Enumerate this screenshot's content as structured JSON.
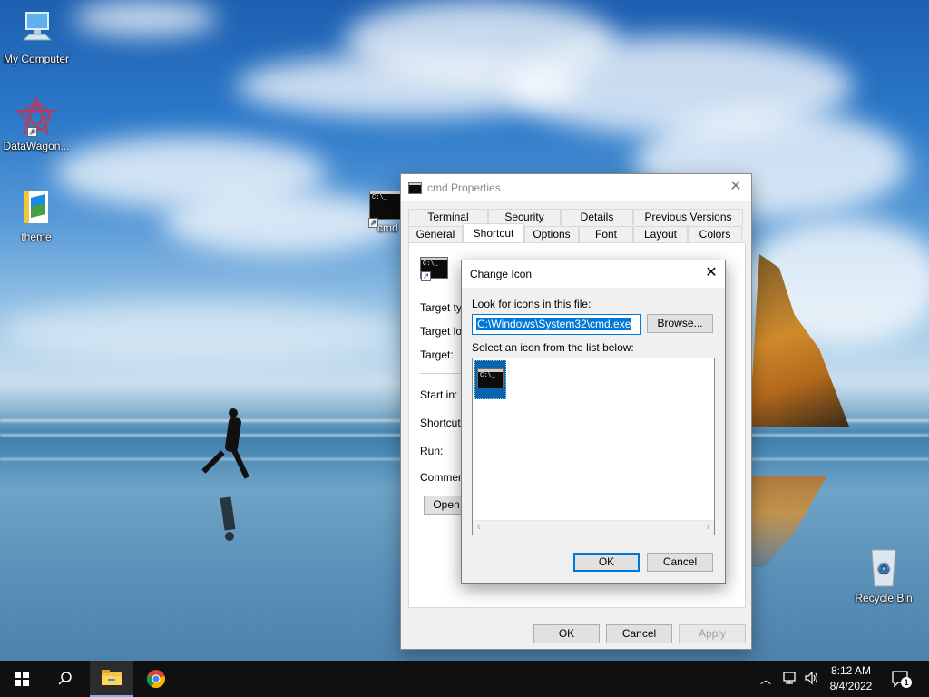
{
  "desktop": {
    "icons": [
      {
        "label": "My Computer"
      },
      {
        "label": "DataWagon..."
      },
      {
        "label": "theme"
      },
      {
        "label": "cmd"
      },
      {
        "label": "Recycle Bin"
      }
    ]
  },
  "properties_window": {
    "title": "cmd Properties",
    "tabs_row1": [
      "Terminal",
      "Security",
      "Details",
      "Previous Versions"
    ],
    "tabs_row2": [
      "General",
      "Shortcut",
      "Options",
      "Font",
      "Layout",
      "Colors"
    ],
    "active_tab": "Shortcut",
    "fields": {
      "target_type": "Target typ",
      "target_location": "Target loc",
      "target": "Target:",
      "start_in": "Start in:",
      "shortcut_key": "Shortcut k",
      "run": "Run:",
      "comment": "Comment:"
    },
    "open_button": "Open",
    "ok": "OK",
    "cancel": "Cancel",
    "apply": "Apply"
  },
  "change_icon_dialog": {
    "title": "Change Icon",
    "look_for_label": "Look for icons in this file:",
    "path_value": "C:\\Windows\\System32\\cmd.exe",
    "browse_button": "Browse...",
    "select_label": "Select an icon from the list below:",
    "ok": "OK",
    "cancel": "Cancel"
  },
  "cmd_glyph_text": "C:\\_",
  "taskbar": {
    "time": "8:12 AM",
    "date": "8/4/2022",
    "notification_count": "1"
  },
  "colors": {
    "accent": "#0078d7",
    "taskbar": "#101010"
  }
}
